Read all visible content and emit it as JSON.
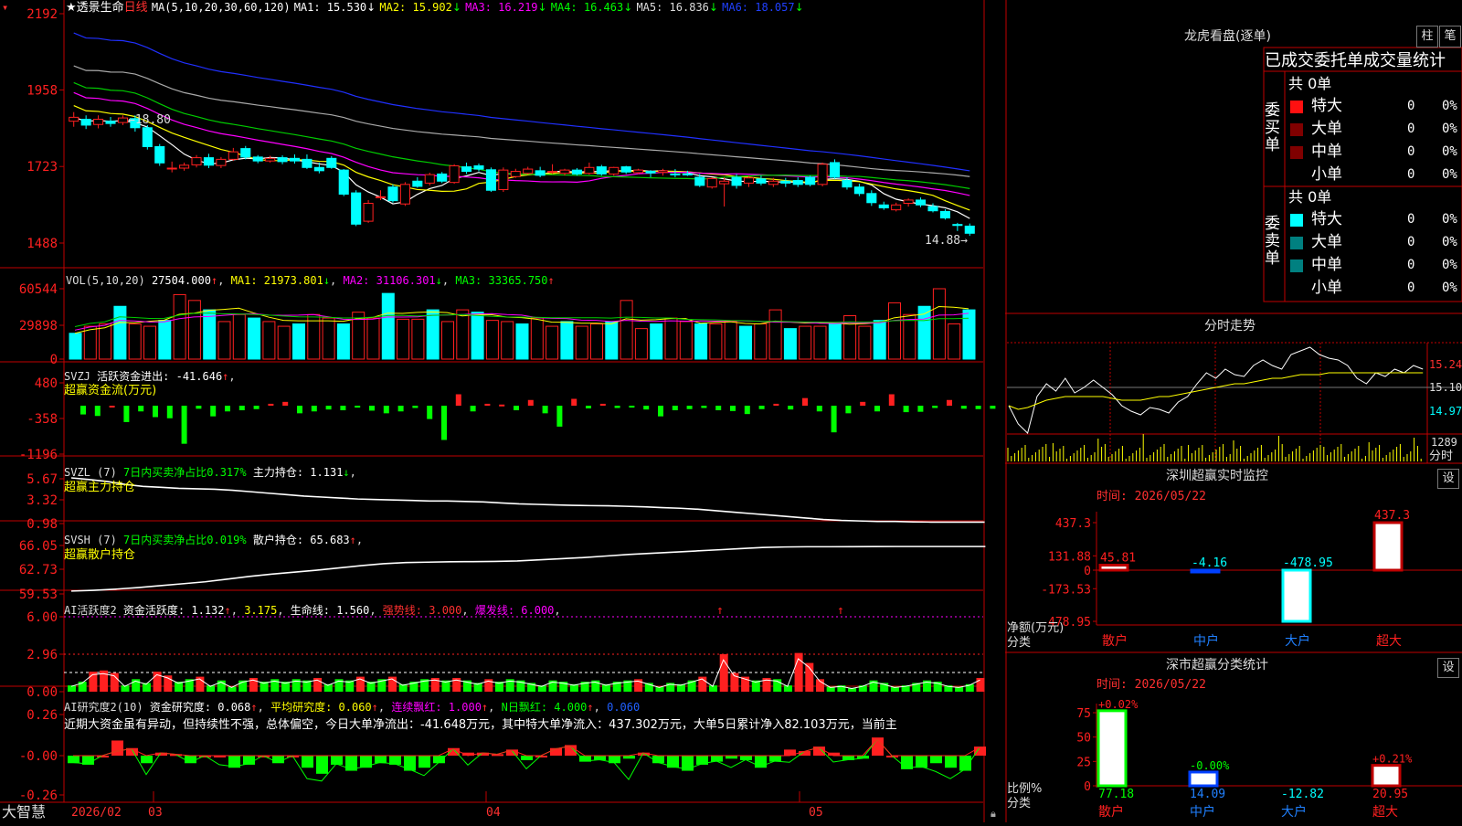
{
  "stock": {
    "name": "透景生命",
    "period": "日线"
  },
  "candles": [
    [
      1862,
      1874,
      1890,
      1845
    ],
    [
      1868,
      1850,
      1880,
      1838
    ],
    [
      1852,
      1868,
      1880,
      1840
    ],
    [
      1862,
      1855,
      1875,
      1845
    ],
    [
      1858,
      1872,
      1880,
      1850
    ],
    [
      1870,
      1842,
      1880,
      1830
    ],
    [
      1842,
      1784,
      1850,
      1775
    ],
    [
      1784,
      1734,
      1792,
      1725
    ],
    [
      1716,
      1718,
      1738,
      1705
    ],
    [
      1718,
      1727,
      1735,
      1710
    ],
    [
      1728,
      1750,
      1758,
      1720
    ],
    [
      1750,
      1727,
      1762,
      1718
    ],
    [
      1726,
      1745,
      1752,
      1718
    ],
    [
      1745,
      1768,
      1780,
      1740
    ],
    [
      1778,
      1752,
      1786,
      1745
    ],
    [
      1752,
      1740,
      1758,
      1733
    ],
    [
      1740,
      1748,
      1756,
      1735
    ],
    [
      1750,
      1738,
      1757,
      1730
    ],
    [
      1748,
      1740,
      1760,
      1732
    ],
    [
      1745,
      1720,
      1760,
      1715
    ],
    [
      1720,
      1710,
      1735,
      1702
    ],
    [
      1748,
      1720,
      1755,
      1716
    ],
    [
      1712,
      1638,
      1715,
      1632
    ],
    [
      1642,
      1546,
      1650,
      1540
    ],
    [
      1555,
      1610,
      1620,
      1550
    ],
    [
      1630,
      1630,
      1650,
      1620
    ],
    [
      1660,
      1618,
      1668,
      1612
    ],
    [
      1608,
      1668,
      1675,
      1602
    ],
    [
      1678,
      1662,
      1690,
      1658
    ],
    [
      1672,
      1698,
      1704,
      1665
    ],
    [
      1700,
      1678,
      1706,
      1672
    ],
    [
      1674,
      1725,
      1730,
      1670
    ],
    [
      1722,
      1708,
      1735,
      1700
    ],
    [
      1725,
      1715,
      1732,
      1708
    ],
    [
      1713,
      1650,
      1720,
      1645
    ],
    [
      1652,
      1712,
      1720,
      1645
    ],
    [
      1692,
      1708,
      1716,
      1688
    ],
    [
      1702,
      1715,
      1722,
      1698
    ],
    [
      1710,
      1696,
      1722,
      1690
    ],
    [
      1705,
      1708,
      1730,
      1700
    ],
    [
      1702,
      1712,
      1716,
      1695
    ],
    [
      1712,
      1700,
      1718,
      1695
    ],
    [
      1702,
      1720,
      1735,
      1698
    ],
    [
      1722,
      1700,
      1728,
      1695
    ],
    [
      1700,
      1720,
      1722,
      1695
    ],
    [
      1722,
      1706,
      1725,
      1700
    ],
    [
      1704,
      1712,
      1716,
      1700
    ],
    [
      1708,
      1703,
      1712,
      1690
    ],
    [
      1705,
      1710,
      1716,
      1695
    ],
    [
      1700,
      1698,
      1715,
      1690
    ],
    [
      1700,
      1698,
      1710,
      1694
    ],
    [
      1690,
      1665,
      1700,
      1660
    ],
    [
      1660,
      1686,
      1690,
      1655
    ],
    [
      1670,
      1678,
      1690,
      1600
    ],
    [
      1690,
      1665,
      1700,
      1655
    ],
    [
      1672,
      1688,
      1695,
      1660
    ],
    [
      1685,
      1672,
      1695,
      1665
    ],
    [
      1668,
      1678,
      1688,
      1660
    ],
    [
      1678,
      1672,
      1688,
      1660
    ],
    [
      1680,
      1668,
      1690,
      1660
    ],
    [
      1690,
      1668,
      1695,
      1662
    ],
    [
      1668,
      1730,
      1735,
      1662
    ],
    [
      1735,
      1690,
      1745,
      1685
    ],
    [
      1680,
      1660,
      1690,
      1652
    ],
    [
      1660,
      1640,
      1670,
      1632
    ],
    [
      1640,
      1612,
      1650,
      1602
    ],
    [
      1605,
      1596,
      1615,
      1590
    ],
    [
      1590,
      1605,
      1612,
      1585
    ],
    [
      1610,
      1620,
      1625,
      1600
    ],
    [
      1620,
      1605,
      1628,
      1598
    ],
    [
      1600,
      1587,
      1610,
      1582
    ],
    [
      1585,
      1565,
      1592,
      1560
    ],
    [
      1545,
      1542,
      1550,
      1525
    ],
    [
      1540,
      1518,
      1548,
      1510
    ]
  ],
  "candle_labels": {
    "high": "18.80",
    "low": "14.88"
  },
  "main_panel": {
    "y_ticks": [
      "2192",
      "1958",
      "1723",
      "1488"
    ],
    "ma_params": "MA(5,10,20,30,60,120)",
    "ma_labels": [
      "MA1: 15.530",
      "MA2: 15.902",
      "MA3: 16.219",
      "MA4: 16.463",
      "MA5: 16.836",
      "MA6: 18.057"
    ]
  },
  "vol_panel": {
    "title": "VOL(5,10,20)",
    "value": "27504.000",
    "ma_labels": [
      "MA1: 21973.801",
      "MA2: 31106.301",
      "MA3: 33365.750"
    ],
    "y_ticks": [
      "60544",
      "29898",
      "0"
    ],
    "values": [
      22,
      28,
      30,
      45,
      30,
      28,
      33,
      55,
      50,
      42,
      32,
      38,
      35,
      32,
      28,
      30,
      38,
      35,
      30,
      40,
      35,
      56,
      34,
      34,
      42,
      32,
      42,
      40,
      33,
      32,
      30,
      35,
      28,
      32,
      28,
      30,
      32,
      50,
      26,
      30,
      35,
      32,
      30,
      30,
      32,
      28,
      30,
      42,
      26,
      28,
      28,
      30,
      37,
      28,
      33,
      48,
      38,
      45,
      60,
      30,
      42,
      55,
      30,
      48,
      42,
      32,
      42,
      58,
      32,
      40,
      38,
      35,
      30,
      40,
      40,
      38,
      39,
      38,
      35,
      40,
      38,
      35,
      60,
      30,
      48,
      38,
      43,
      72,
      38,
      25,
      25,
      28,
      40,
      50,
      28,
      28,
      32,
      40,
      38,
      40,
      37,
      25,
      32,
      33,
      30,
      35,
      38,
      50,
      60,
      48,
      52,
      35,
      26,
      33,
      63,
      32,
      40,
      38,
      44,
      30,
      26,
      22,
      25,
      38,
      45,
      40,
      38,
      30
    ]
  },
  "svzj_panel": {
    "title": "SVZJ",
    "label": "活跃资金进出: -41.646",
    "subtitle": "超赢资金流(万元)",
    "y_ticks": [
      "480",
      "-358",
      "-1196"
    ],
    "values": [
      -230,
      -270,
      0,
      -430,
      -150,
      -300,
      -330,
      -1000,
      -80,
      -280,
      -150,
      -120,
      -90,
      50,
      100,
      -200,
      -150,
      -100,
      -120,
      -50,
      -130,
      -200,
      -150,
      -60,
      -350,
      -900,
      300,
      -150,
      50,
      30,
      -120,
      150,
      -200,
      -550,
      180,
      -70,
      50,
      -60,
      -50,
      -100,
      -280,
      -120,
      -90,
      -60,
      -120,
      -140,
      -220,
      -90,
      50,
      -100,
      200,
      -150,
      -700,
      -200,
      100,
      -150,
      300,
      -170,
      -160,
      -60,
      150,
      -80,
      -90,
      -80
    ]
  },
  "svzl_panel": {
    "title": "SVZL (7)",
    "label1": "7日内买卖净占比0.317%",
    "label2": "主力持仓: 1.131",
    "subtitle": "超赢主力持仓",
    "y_ticks": [
      "5.67",
      "3.32",
      "0.98"
    ],
    "values": [
      5.67,
      5.5,
      5.3,
      5.0,
      4.8,
      4.7,
      4.6,
      4.55,
      4.5,
      4.4,
      4.25,
      4.1,
      3.95,
      3.8,
      3.7,
      3.6,
      3.5,
      3.45,
      3.4,
      3.35,
      3.3,
      3.3,
      3.25,
      3.2,
      3.1,
      3.0,
      2.95,
      2.9,
      2.85,
      2.82,
      2.8,
      2.75,
      2.7,
      2.62,
      2.55,
      2.45,
      2.3,
      2.15,
      2.0,
      1.85,
      1.7,
      1.55,
      1.4,
      1.3,
      1.25,
      1.2,
      1.2,
      1.15,
      1.13,
      1.13,
      1.13,
      1.13
    ]
  },
  "svsh_panel": {
    "title": "SVSH (7)",
    "label1": "7日内买卖净占比0.019%",
    "label2": "散户持仓: 65.683",
    "subtitle": "超赢散户持仓",
    "y_ticks": [
      "66.05",
      "62.73",
      "59.53"
    ],
    "values": [
      59.9,
      60.0,
      60.15,
      60.35,
      60.6,
      60.85,
      61.1,
      61.45,
      61.8,
      62.1,
      62.35,
      62.6,
      62.9,
      63.2,
      63.45,
      63.6,
      63.65,
      63.7,
      63.72,
      63.75,
      63.8,
      63.95,
      64.1,
      64.25,
      64.45,
      64.65,
      64.8,
      64.95,
      65.1,
      65.25,
      65.4,
      65.55,
      65.62,
      65.65,
      65.65,
      65.66,
      65.67,
      65.68,
      65.68,
      65.68,
      65.68,
      65.68
    ]
  },
  "ai_panel": {
    "title": "AI活跃度2",
    "label": "资金活跃度: 1.132",
    "val2": "3.175",
    "life": "生命线: 1.560",
    "strong": "强势线: 3.000",
    "burst": "爆发线: 6.000",
    "y_ticks": [
      "6.00",
      "2.96",
      "0.00"
    ],
    "values": [
      0.5,
      0.8,
      1.6,
      1.7,
      1.5,
      0.5,
      1.0,
      0.7,
      1.6,
      1.3,
      0.8,
      1.0,
      1.2,
      0.5,
      0.9,
      0.4,
      0.9,
      1.1,
      0.8,
      1.0,
      0.8,
      1.0,
      0.9,
      1.1,
      0.6,
      1.0,
      0.9,
      1.2,
      0.8,
      1.0,
      1.2,
      0.6,
      0.8,
      1.0,
      1.1,
      0.9,
      1.1,
      0.9,
      0.7,
      1.0,
      0.8,
      1.0,
      0.9,
      0.7,
      0.5,
      0.9,
      0.8,
      0.6,
      0.8,
      0.9,
      0.6,
      0.8,
      0.9,
      1.0,
      0.7,
      0.4,
      0.7,
      0.6,
      0.9,
      1.2,
      0.5,
      3.0,
      1.5,
      1.2,
      0.9,
      1.1,
      1.0,
      0.5,
      3.1,
      2.3,
      1.0,
      0.4,
      0.5,
      0.3,
      0.5,
      0.9,
      0.7,
      0.4,
      0.5,
      0.7,
      0.9,
      0.8,
      0.5,
      0.4,
      0.6,
      1.1
    ],
    "bar_colors": [
      "g",
      "g",
      "r",
      "r",
      "r",
      "g",
      "g",
      "g",
      "r",
      "r",
      "g",
      "g",
      "r",
      "g",
      "g",
      "g",
      "g",
      "r",
      "g",
      "g",
      "g",
      "g",
      "g",
      "r",
      "g",
      "g",
      "g",
      "r",
      "g",
      "g",
      "r",
      "g",
      "g",
      "g",
      "r",
      "g",
      "r",
      "g",
      "g",
      "r",
      "g",
      "g",
      "g",
      "g",
      "g",
      "g",
      "g",
      "g",
      "g",
      "g",
      "g",
      "g",
      "g",
      "r",
      "g",
      "g",
      "g",
      "g",
      "g",
      "r",
      "g",
      "r",
      "r",
      "r",
      "g",
      "r",
      "g",
      "g",
      "r",
      "r",
      "r",
      "g",
      "g",
      "g",
      "g",
      "g",
      "g",
      "g",
      "g",
      "g",
      "g",
      "g",
      "g",
      "g",
      "g",
      "r"
    ]
  },
  "ai2_panel": {
    "title": "AI研究度2(10)",
    "label": "资金研究度: 0.068",
    "avg": "平均研究度: 0.060",
    "red": "连续飘红: 1.000",
    "nred": "N日飘红: 4.000",
    "extra": "0.060",
    "y_ticks": [
      "0.26",
      "-0.00",
      "-0.26"
    ],
    "comment": "近期大资金虽有异动，但持续性不强，总体偏空，今日大单净流出：-41.648万元，其中特大单净流入：437.302万元，大单5日累计净入82.103万元，当前主",
    "values": [
      -0.05,
      -0.06,
      0.0,
      0.1,
      0.05,
      -0.05,
      0.02,
      0.01,
      -0.05,
      0.0,
      0.0,
      -0.08,
      -0.06,
      0.0,
      -0.05,
      0.0,
      -0.08,
      -0.12,
      -0.06,
      -0.1,
      -0.08,
      -0.05,
      -0.06,
      -0.1,
      -0.08,
      -0.05,
      0.05,
      0.02,
      0.02,
      0.01,
      0.04,
      -0.03,
      0.0,
      0.05,
      0.07,
      -0.04,
      -0.03,
      -0.05,
      -0.02,
      0.02,
      -0.05,
      -0.08,
      -0.1,
      -0.06,
      -0.04,
      -0.02,
      -0.03,
      -0.08,
      -0.04,
      0.04,
      0.03,
      0.06,
      0.02,
      -0.03,
      -0.02,
      0.12,
      0.0,
      -0.09,
      -0.08,
      -0.05,
      -0.08,
      -0.1,
      0.06
    ]
  },
  "time_axis": {
    "labels": [
      "2026/02",
      "03",
      "04",
      "05"
    ],
    "brand": "大智慧"
  },
  "right": {
    "title": "龙虎看盘(逐单)",
    "btn1": "柱",
    "btn2": "笔",
    "section": "已成交委托单成交量统计",
    "buy_total": "共 0单",
    "sell_total": "共 0单",
    "buy_side": "委买单",
    "sell_side": "委卖单",
    "buy_rows": [
      {
        "label": "特大",
        "count": "0",
        "pct": "0%",
        "color": "#ff1010"
      },
      {
        "label": "大单",
        "count": "0",
        "pct": "0%",
        "color": "#800000"
      },
      {
        "label": "中单",
        "count": "0",
        "pct": "0%",
        "color": "#800000"
      },
      {
        "label": "小单",
        "count": "0",
        "pct": "0%",
        "color": ""
      }
    ],
    "sell_rows": [
      {
        "label": "特大",
        "count": "0",
        "pct": "0%",
        "color": "#00ffff"
      },
      {
        "label": "大单",
        "count": "0",
        "pct": "0%",
        "color": "#008080"
      },
      {
        "label": "中单",
        "count": "0",
        "pct": "0%",
        "color": "#008080"
      },
      {
        "label": "小单",
        "count": "0",
        "pct": "0%",
        "color": ""
      }
    ],
    "intraday": {
      "title": "分时走势",
      "y_labels": [
        "15.24",
        "15.10",
        "14.97"
      ],
      "vol_label": "1289",
      "vol_label2": "分时",
      "price": [
        15.0,
        14.9,
        14.85,
        15.05,
        15.12,
        15.08,
        15.15,
        15.07,
        15.1,
        15.14,
        15.1,
        15.06,
        15.0,
        14.97,
        14.95,
        14.99,
        14.98,
        14.96,
        15.02,
        15.05,
        15.12,
        15.18,
        15.15,
        15.2,
        15.17,
        15.16,
        15.22,
        15.25,
        15.22,
        15.2,
        15.28,
        15.3,
        15.32,
        15.28,
        15.26,
        15.25,
        15.22,
        15.15,
        15.12,
        15.18,
        15.16,
        15.2,
        15.18,
        15.22,
        15.2
      ],
      "avg": [
        15.0,
        14.98,
        14.99,
        15.01,
        15.03,
        15.04,
        15.05,
        15.05,
        15.05,
        15.05,
        15.05,
        15.04,
        15.03,
        15.03,
        15.03,
        15.04,
        15.05,
        15.05,
        15.06,
        15.07,
        15.08,
        15.09,
        15.1,
        15.11,
        15.12,
        15.12,
        15.13,
        15.14,
        15.15,
        15.15,
        15.16,
        15.17,
        15.17,
        15.17,
        15.18,
        15.18,
        15.18,
        15.18,
        15.18,
        15.18,
        15.18,
        15.18,
        15.18,
        15.18,
        15.18
      ]
    },
    "monitor": {
      "title": "深圳超赢实时监控",
      "btn": "设",
      "time": "时间: 2026/05/22",
      "y_ticks": [
        "437.3",
        "131.88",
        "0",
        "-173.53",
        "-478.95"
      ],
      "ylabel": "净额(万元)",
      "xlabel": "分类",
      "cats": [
        "散户",
        "中户",
        "大户",
        "超大"
      ],
      "values": [
        45.81,
        -4.16,
        -478.95,
        437.3
      ],
      "value_labels": [
        "45.81",
        "-4.16",
        "-478.95",
        "437.3"
      ]
    },
    "classify": {
      "title": "深市超赢分类统计",
      "btn": "设",
      "time": "时间: 2026/05/22",
      "y_ticks": [
        "75",
        "50",
        "25",
        "0"
      ],
      "ylabel": "比例%",
      "xlabel": "分类",
      "cats": [
        "散户",
        "中户",
        "大户",
        "超大"
      ],
      "values": [
        77.18,
        14.09,
        -12.82,
        20.95
      ],
      "value_labels": [
        "77.18",
        "14.09",
        "-12.82",
        "20.95"
      ],
      "pct_labels": [
        "+0.02%",
        "-0.00%",
        "",
        "+0.21%"
      ]
    }
  },
  "chart_data": [
    {
      "type": "candlestick",
      "title": "透景生命 日线",
      "ylim": [
        1488,
        2192
      ],
      "ma_legend": [
        "MA1",
        "MA2",
        "MA3",
        "MA4",
        "MA5",
        "MA6"
      ]
    },
    {
      "type": "bar",
      "title": "深圳超赢实时监控",
      "categories": [
        "散户",
        "中户",
        "大户",
        "超大"
      ],
      "values": [
        45.81,
        -4.16,
        -478.95,
        437.3
      ],
      "ylabel": "净额(万元)",
      "xlabel": "分类",
      "ylim": [
        -478.95,
        437.3
      ]
    },
    {
      "type": "bar",
      "title": "深市超赢分类统计",
      "categories": [
        "散户",
        "中户",
        "大户",
        "超大"
      ],
      "values": [
        77.18,
        14.09,
        -12.82,
        20.95
      ],
      "ylabel": "比例%",
      "xlabel": "分类",
      "ylim": [
        0,
        75
      ]
    }
  ]
}
